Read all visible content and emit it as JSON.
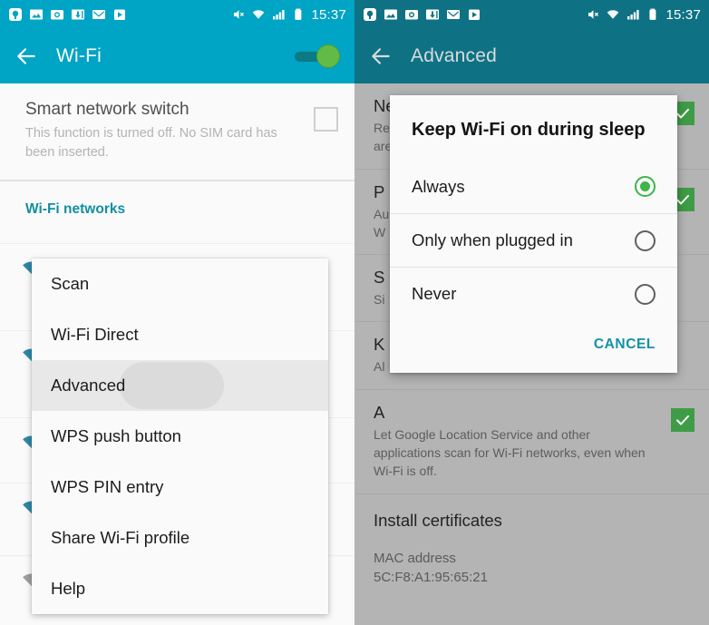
{
  "left_screen": {
    "statusbar": {
      "time": "15:37",
      "left_icons": [
        "chat-icon",
        "photo-icon",
        "camera-icon",
        "download-icon",
        "gmail-icon",
        "play-store-icon"
      ],
      "right_icons": [
        "mute-icon",
        "wifi-icon",
        "signal-icon",
        "battery-icon"
      ]
    },
    "appbar": {
      "back": "back-arrow-icon",
      "title": "Wi-Fi",
      "toggle_state": "on"
    },
    "smart_network_switch": {
      "title": "Smart network switch",
      "subtitle": "This function is turned off. No SIM card has been inserted.",
      "checked": false
    },
    "section_header": "Wi-Fi networks",
    "menu": {
      "items": [
        {
          "label": "Scan",
          "highlighted": false
        },
        {
          "label": "Wi-Fi Direct",
          "highlighted": false
        },
        {
          "label": "Advanced",
          "highlighted": true
        },
        {
          "label": "WPS push button",
          "highlighted": false
        },
        {
          "label": "WPS PIN entry",
          "highlighted": false
        },
        {
          "label": "Share Wi-Fi profile",
          "highlighted": false
        },
        {
          "label": "Help",
          "highlighted": false
        }
      ]
    }
  },
  "right_screen": {
    "statusbar": {
      "time": "15:37"
    },
    "appbar": {
      "back": "back-arrow-icon",
      "title": "Advanced"
    },
    "prefs": [
      {
        "title": "Network notification",
        "subtitle": "Receive notifications when open networks in range are detected.",
        "checked": true
      },
      {
        "title": "P",
        "subtitle": "Au\nW",
        "checked": true
      },
      {
        "title": "S",
        "subtitle": "Si",
        "checked": false
      },
      {
        "title": "K",
        "subtitle": "Al",
        "checked": false
      },
      {
        "title": "A",
        "subtitle": "Let Google Location Service and other applications scan for Wi-Fi networks, even when Wi-Fi is off.",
        "checked": true
      }
    ],
    "install_certificates": "Install certificates",
    "mac": {
      "label": "MAC address",
      "value": "5C:F8:A1:95:65:21"
    },
    "dialog": {
      "title": "Keep Wi-Fi on during sleep",
      "options": [
        {
          "label": "Always",
          "selected": true
        },
        {
          "label": "Only when plugged in",
          "selected": false
        },
        {
          "label": "Never",
          "selected": false
        }
      ],
      "cancel_label": "CANCEL"
    }
  },
  "colors": {
    "left_accent": "#00a4c4",
    "right_accent": "#0e7284",
    "section_teal": "#128fa0",
    "green": "#3f9c46",
    "radio_green": "#3cb54a",
    "cancel_teal": "#1292a6"
  }
}
